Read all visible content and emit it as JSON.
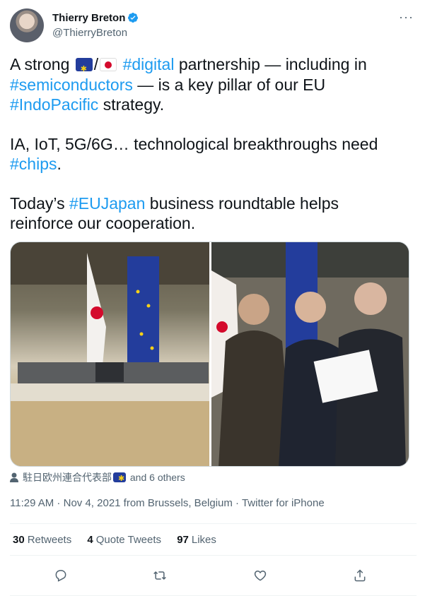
{
  "author": {
    "name": "Thierry Breton",
    "handle": "@ThierryBreton",
    "verified": true
  },
  "tweet": {
    "p1": {
      "t1": "A strong ",
      "t2": "/",
      "t3": " ",
      "h1": "#digital",
      "t4": " partnership — including in ",
      "h2": "#semiconductors",
      "t5": " — is a key pillar of our EU ",
      "h3": "#IndoPacific",
      "t6": " strategy."
    },
    "p2": {
      "t1": "IA, IoT, 5G/6G… technological breakthroughs need ",
      "h1": "#chips",
      "t2": "."
    },
    "p3": {
      "t1": "Today’s ",
      "h1": "#EUJapan",
      "t2": " business roundtable helps reinforce our cooperation."
    }
  },
  "tagged": {
    "prefix": "駐日欧州連合代表部",
    "suffix": " and 6 others"
  },
  "meta": {
    "time": "11:29 AM",
    "sep1": " · ",
    "date": "Nov 4, 2021",
    "location": " from Brussels, Belgium",
    "sep2": " · ",
    "source": "Twitter for iPhone"
  },
  "stats": [
    {
      "count": "30",
      "label": "Retweets"
    },
    {
      "count": "4",
      "label": "Quote Tweets"
    },
    {
      "count": "97",
      "label": "Likes"
    }
  ],
  "actions": [
    "reply-icon",
    "retweet-icon",
    "like-icon",
    "share-icon"
  ],
  "colors": {
    "link": "#1d9bf0",
    "muted": "#536471",
    "text": "#0f1419"
  }
}
